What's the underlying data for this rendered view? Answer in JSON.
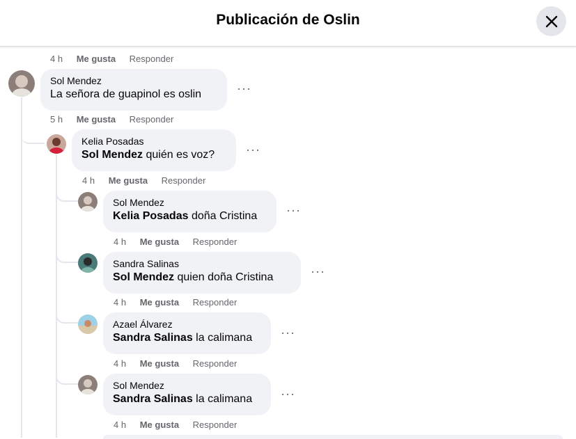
{
  "header": {
    "title": "Publicación de Oslin"
  },
  "actions": {
    "like": "Me gusta",
    "reply": "Responder"
  },
  "thread": [
    {
      "time": "4 h"
    },
    {
      "author": "Sol Mendez",
      "mention": "",
      "text": "La señora de guapinol es oslin",
      "time": "5 h"
    },
    {
      "author": "Kelia Posadas",
      "mention": "Sol Mendez",
      "text": "quién es voz?",
      "time": "4 h"
    },
    {
      "author": "Sol Mendez",
      "mention": "Kelia Posadas",
      "text": "doña Cristina",
      "time": "4 h"
    },
    {
      "author": "Sandra Salinas",
      "mention": "Sol Mendez",
      "text": "quien doña Cristina",
      "time": "4 h"
    },
    {
      "author": "Azael Álvarez",
      "mention": "Sandra Salinas",
      "text": "la calimana",
      "time": "4 h"
    },
    {
      "author": "Sol Mendez",
      "mention": "Sandra Salinas",
      "text": "la calimana",
      "time": "4 h"
    }
  ],
  "colors": {
    "bubble": "#f0f2f5",
    "meta": "#65676b",
    "text": "#050505",
    "close_bg": "#e4e6eb"
  },
  "icons": {
    "close": "close-icon",
    "more": "more-options-icon"
  }
}
